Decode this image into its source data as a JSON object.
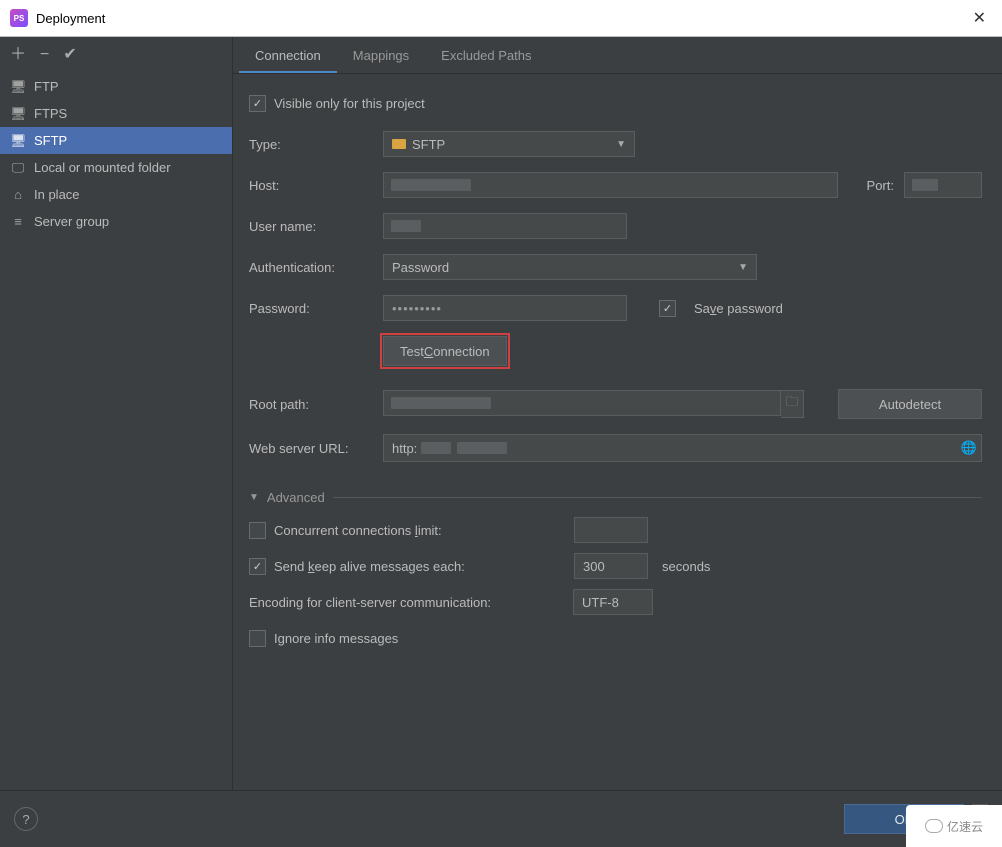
{
  "window": {
    "title": "Deployment"
  },
  "sidebar": {
    "items": [
      {
        "label": "FTP"
      },
      {
        "label": "FTPS"
      },
      {
        "label": "SFTP"
      },
      {
        "label": "Local or mounted folder"
      },
      {
        "label": "In place"
      },
      {
        "label": "Server group"
      }
    ]
  },
  "tabs": {
    "connection": "Connection",
    "mappings": "Mappings",
    "excluded": "Excluded Paths"
  },
  "form": {
    "visible_only_label": "Visible only for this project",
    "visible_only_checked": "✓",
    "type_label": "Type:",
    "type_value": "SFTP",
    "host_label": "Host:",
    "host_value": "",
    "port_label": "Port:",
    "port_value": "",
    "user_label": "User name:",
    "user_value": "",
    "auth_label": "Authentication:",
    "auth_value": "Password",
    "password_label": "Password:",
    "password_value": "•••••••••",
    "save_password_label": "Save password",
    "save_password_checked": "✓",
    "test_connection_label": "Test Connection",
    "root_path_label": "Root path:",
    "root_path_value": "",
    "autodetect_label": "Autodetect",
    "web_url_label": "Web server URL:",
    "web_url_value": "http:",
    "advanced_label": "Advanced",
    "concurrent_label": "Concurrent connections limit:",
    "concurrent_value": "",
    "keepalive_label": "Send keep alive messages each:",
    "keepalive_checked": "✓",
    "keepalive_value": "300",
    "keepalive_unit": "seconds",
    "encoding_label": "Encoding for client-server communication:",
    "encoding_value": "UTF-8",
    "ignore_info_label": "Ignore info messages"
  },
  "footer": {
    "ok": "OK"
  },
  "watermark": "亿速云"
}
